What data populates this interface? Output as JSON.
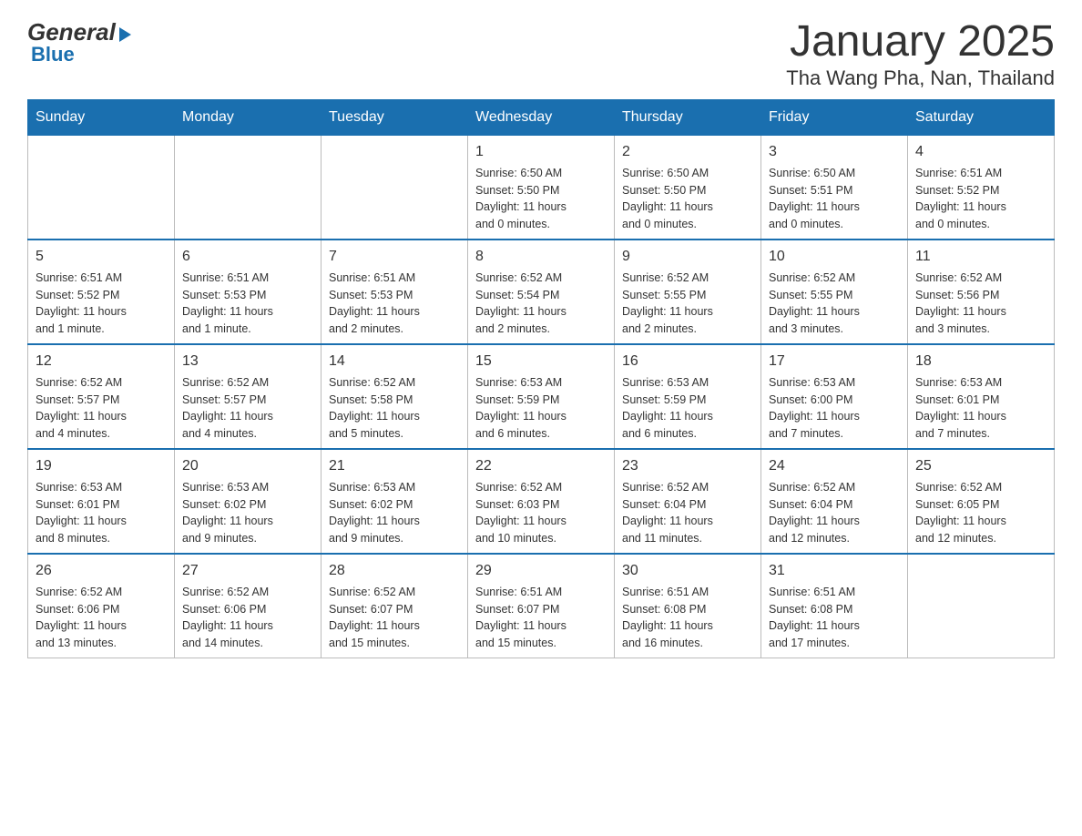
{
  "header": {
    "month_title": "January 2025",
    "location": "Tha Wang Pha, Nan, Thailand",
    "logo_general": "General",
    "logo_blue": "Blue"
  },
  "weekdays": [
    "Sunday",
    "Monday",
    "Tuesday",
    "Wednesday",
    "Thursday",
    "Friday",
    "Saturday"
  ],
  "weeks": [
    [
      {
        "day": "",
        "info": ""
      },
      {
        "day": "",
        "info": ""
      },
      {
        "day": "",
        "info": ""
      },
      {
        "day": "1",
        "info": "Sunrise: 6:50 AM\nSunset: 5:50 PM\nDaylight: 11 hours\nand 0 minutes."
      },
      {
        "day": "2",
        "info": "Sunrise: 6:50 AM\nSunset: 5:50 PM\nDaylight: 11 hours\nand 0 minutes."
      },
      {
        "day": "3",
        "info": "Sunrise: 6:50 AM\nSunset: 5:51 PM\nDaylight: 11 hours\nand 0 minutes."
      },
      {
        "day": "4",
        "info": "Sunrise: 6:51 AM\nSunset: 5:52 PM\nDaylight: 11 hours\nand 0 minutes."
      }
    ],
    [
      {
        "day": "5",
        "info": "Sunrise: 6:51 AM\nSunset: 5:52 PM\nDaylight: 11 hours\nand 1 minute."
      },
      {
        "day": "6",
        "info": "Sunrise: 6:51 AM\nSunset: 5:53 PM\nDaylight: 11 hours\nand 1 minute."
      },
      {
        "day": "7",
        "info": "Sunrise: 6:51 AM\nSunset: 5:53 PM\nDaylight: 11 hours\nand 2 minutes."
      },
      {
        "day": "8",
        "info": "Sunrise: 6:52 AM\nSunset: 5:54 PM\nDaylight: 11 hours\nand 2 minutes."
      },
      {
        "day": "9",
        "info": "Sunrise: 6:52 AM\nSunset: 5:55 PM\nDaylight: 11 hours\nand 2 minutes."
      },
      {
        "day": "10",
        "info": "Sunrise: 6:52 AM\nSunset: 5:55 PM\nDaylight: 11 hours\nand 3 minutes."
      },
      {
        "day": "11",
        "info": "Sunrise: 6:52 AM\nSunset: 5:56 PM\nDaylight: 11 hours\nand 3 minutes."
      }
    ],
    [
      {
        "day": "12",
        "info": "Sunrise: 6:52 AM\nSunset: 5:57 PM\nDaylight: 11 hours\nand 4 minutes."
      },
      {
        "day": "13",
        "info": "Sunrise: 6:52 AM\nSunset: 5:57 PM\nDaylight: 11 hours\nand 4 minutes."
      },
      {
        "day": "14",
        "info": "Sunrise: 6:52 AM\nSunset: 5:58 PM\nDaylight: 11 hours\nand 5 minutes."
      },
      {
        "day": "15",
        "info": "Sunrise: 6:53 AM\nSunset: 5:59 PM\nDaylight: 11 hours\nand 6 minutes."
      },
      {
        "day": "16",
        "info": "Sunrise: 6:53 AM\nSunset: 5:59 PM\nDaylight: 11 hours\nand 6 minutes."
      },
      {
        "day": "17",
        "info": "Sunrise: 6:53 AM\nSunset: 6:00 PM\nDaylight: 11 hours\nand 7 minutes."
      },
      {
        "day": "18",
        "info": "Sunrise: 6:53 AM\nSunset: 6:01 PM\nDaylight: 11 hours\nand 7 minutes."
      }
    ],
    [
      {
        "day": "19",
        "info": "Sunrise: 6:53 AM\nSunset: 6:01 PM\nDaylight: 11 hours\nand 8 minutes."
      },
      {
        "day": "20",
        "info": "Sunrise: 6:53 AM\nSunset: 6:02 PM\nDaylight: 11 hours\nand 9 minutes."
      },
      {
        "day": "21",
        "info": "Sunrise: 6:53 AM\nSunset: 6:02 PM\nDaylight: 11 hours\nand 9 minutes."
      },
      {
        "day": "22",
        "info": "Sunrise: 6:52 AM\nSunset: 6:03 PM\nDaylight: 11 hours\nand 10 minutes."
      },
      {
        "day": "23",
        "info": "Sunrise: 6:52 AM\nSunset: 6:04 PM\nDaylight: 11 hours\nand 11 minutes."
      },
      {
        "day": "24",
        "info": "Sunrise: 6:52 AM\nSunset: 6:04 PM\nDaylight: 11 hours\nand 12 minutes."
      },
      {
        "day": "25",
        "info": "Sunrise: 6:52 AM\nSunset: 6:05 PM\nDaylight: 11 hours\nand 12 minutes."
      }
    ],
    [
      {
        "day": "26",
        "info": "Sunrise: 6:52 AM\nSunset: 6:06 PM\nDaylight: 11 hours\nand 13 minutes."
      },
      {
        "day": "27",
        "info": "Sunrise: 6:52 AM\nSunset: 6:06 PM\nDaylight: 11 hours\nand 14 minutes."
      },
      {
        "day": "28",
        "info": "Sunrise: 6:52 AM\nSunset: 6:07 PM\nDaylight: 11 hours\nand 15 minutes."
      },
      {
        "day": "29",
        "info": "Sunrise: 6:51 AM\nSunset: 6:07 PM\nDaylight: 11 hours\nand 15 minutes."
      },
      {
        "day": "30",
        "info": "Sunrise: 6:51 AM\nSunset: 6:08 PM\nDaylight: 11 hours\nand 16 minutes."
      },
      {
        "day": "31",
        "info": "Sunrise: 6:51 AM\nSunset: 6:08 PM\nDaylight: 11 hours\nand 17 minutes."
      },
      {
        "day": "",
        "info": ""
      }
    ]
  ]
}
